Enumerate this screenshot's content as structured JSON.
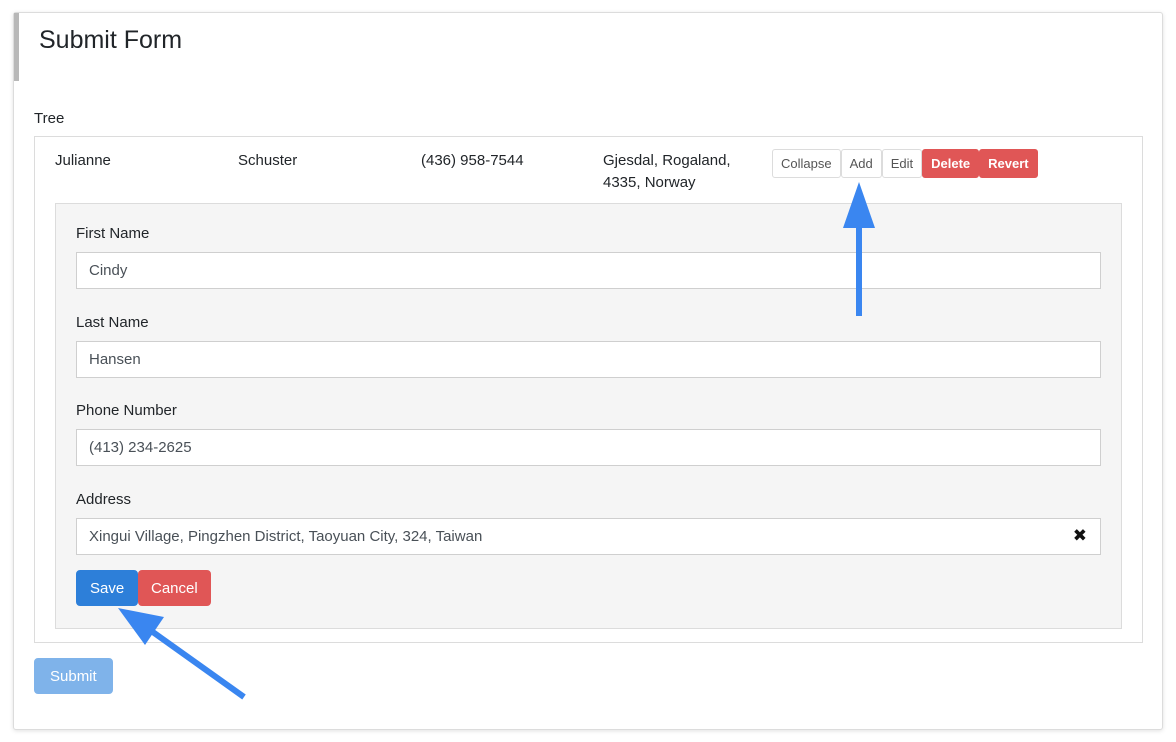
{
  "header": {
    "title": "Submit Form"
  },
  "tree": {
    "label": "Tree",
    "row": {
      "first_name": "Julianne",
      "last_name": "Schuster",
      "phone": "(436) 958-7544",
      "address_line1": "Gjesdal, Rogaland,",
      "address_line2": "4335, Norway"
    },
    "actions": {
      "collapse": "Collapse",
      "add": "Add",
      "edit": "Edit",
      "delete": "Delete",
      "revert": "Revert"
    }
  },
  "form": {
    "first_name": {
      "label": "First Name",
      "value": "Cindy"
    },
    "last_name": {
      "label": "Last Name",
      "value": "Hansen"
    },
    "phone": {
      "label": "Phone Number",
      "value": "(413) 234-2625"
    },
    "address": {
      "label": "Address",
      "value": "Xingui Village, Pingzhen District, Taoyuan City, 324, Taiwan",
      "clear_icon": "✖"
    },
    "save_label": "Save",
    "cancel_label": "Cancel"
  },
  "submit_label": "Submit",
  "colors": {
    "primary": "#2d7fd9",
    "danger": "#e05656",
    "submit_disabled": "#7fb3ea",
    "annotation_arrow": "#3a86f0"
  },
  "icons": {
    "clear": "close-icon"
  }
}
